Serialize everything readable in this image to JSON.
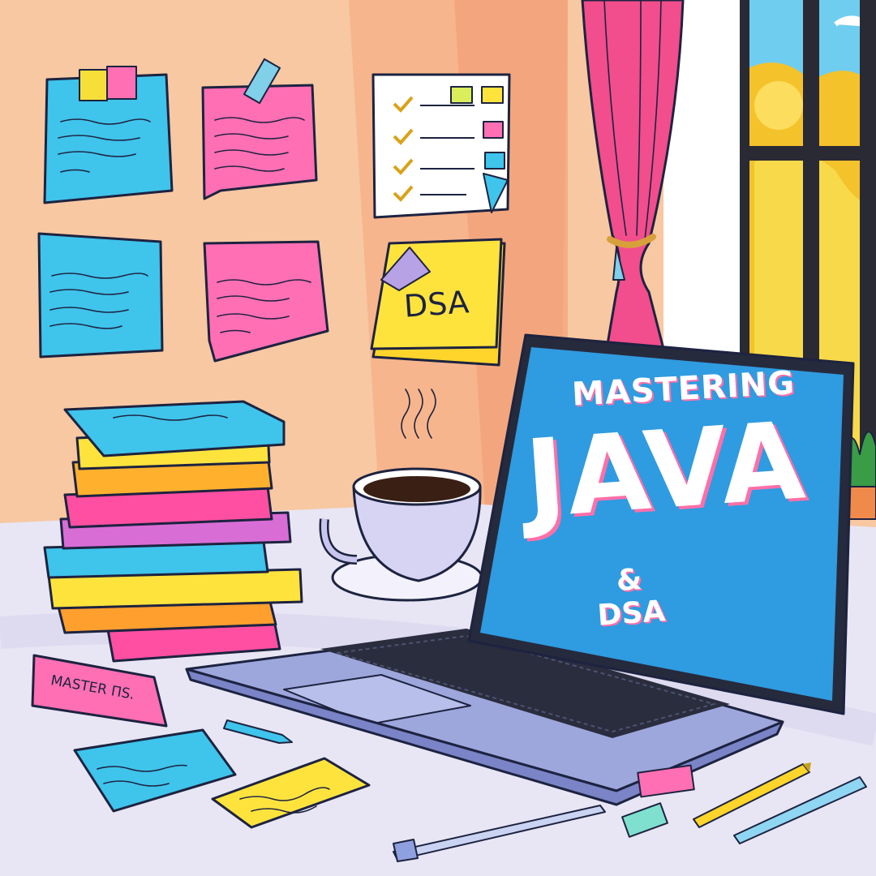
{
  "laptop_screen": {
    "line1": "MASTERING",
    "line2": "JAVA",
    "line3": "& DSA"
  },
  "wall_notes": {
    "dsa_note": "DSA"
  },
  "desk_notes": {
    "pink_note": "MASTER ΠS."
  },
  "colors": {
    "wall": "#f6c7a3",
    "screen": "#2f9be0",
    "note_blue": "#3fc4ec",
    "note_pink": "#ff6fb4",
    "note_yellow": "#ffe33d",
    "curtain": "#f24d8c",
    "desk": "#e8e6f4"
  }
}
